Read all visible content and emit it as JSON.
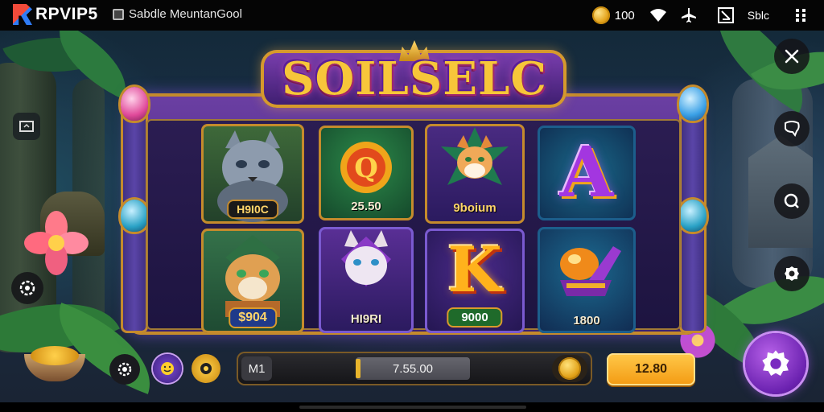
{
  "status_bar": {
    "brand": "RPVIP5",
    "game_title": "Sabdle MeuntanGool",
    "coins": "100",
    "extra_label": "Sblc"
  },
  "slot": {
    "title": "SOILSELC",
    "tiles": [
      {
        "label": "H9I0C",
        "symbol": "grey-cat"
      },
      {
        "label": "25.50",
        "symbol": "coin-q"
      },
      {
        "label": "9boium",
        "symbol": "fox"
      },
      {
        "symbol": "purple-a",
        "letter": "A"
      },
      {
        "label": "$904",
        "symbol": "tiger"
      },
      {
        "label": "HI9RI",
        "symbol": "lynx"
      },
      {
        "label": "9000",
        "symbol": "gold-k",
        "letter": "K"
      },
      {
        "label": "1800",
        "symbol": "treasure"
      }
    ]
  },
  "controls": {
    "bet_mode": "M1",
    "bet_value": "7.55.00",
    "spin_value": "12.80"
  },
  "colors": {
    "accent_gold": "#f39a12",
    "frame_purple": "#6b3fa3",
    "settings_purple": "#8a36cc"
  }
}
